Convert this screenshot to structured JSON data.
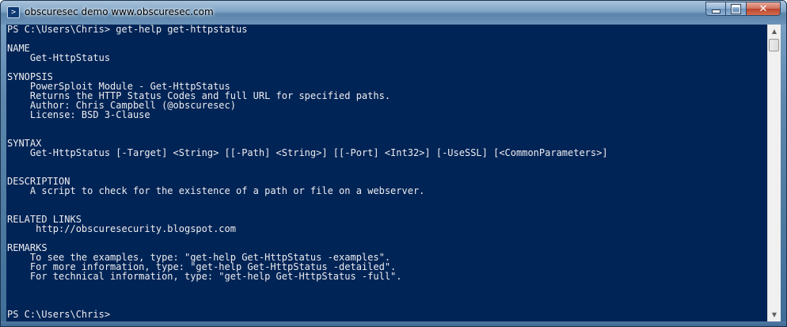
{
  "window": {
    "title": "obscuresec demo www.obscuresec.com",
    "icon": "powershell-icon",
    "controls": {
      "minimize": "minimize-icon",
      "maximize": "maximize-icon",
      "close_label": "✕"
    }
  },
  "console": {
    "lines": [
      "PS C:\\Users\\Chris> get-help get-httpstatus",
      "",
      "NAME",
      "    Get-HttpStatus",
      "",
      "SYNOPSIS",
      "    PowerSploit Module - Get-HttpStatus",
      "    Returns the HTTP Status Codes and full URL for specified paths.",
      "    Author: Chris Campbell (@obscuresec)",
      "    License: BSD 3-Clause",
      "",
      "",
      "SYNTAX",
      "    Get-HttpStatus [-Target] <String> [[-Path] <String>] [[-Port] <Int32>] [-UseSSL] [<CommonParameters>]",
      "",
      "",
      "DESCRIPTION",
      "    A script to check for the existence of a path or file on a webserver.",
      "",
      "",
      "RELATED LINKS",
      "     http://obscuresecurity.blogspot.com",
      "",
      "REMARKS",
      "    To see the examples, type: \"get-help Get-HttpStatus -examples\".",
      "    For more information, type: \"get-help Get-HttpStatus -detailed\".",
      "    For technical information, type: \"get-help Get-HttpStatus -full\".",
      "",
      "",
      "",
      "PS C:\\Users\\Chris>"
    ]
  },
  "colors": {
    "console_background": "#012456",
    "console_text": "#eeedf0"
  }
}
